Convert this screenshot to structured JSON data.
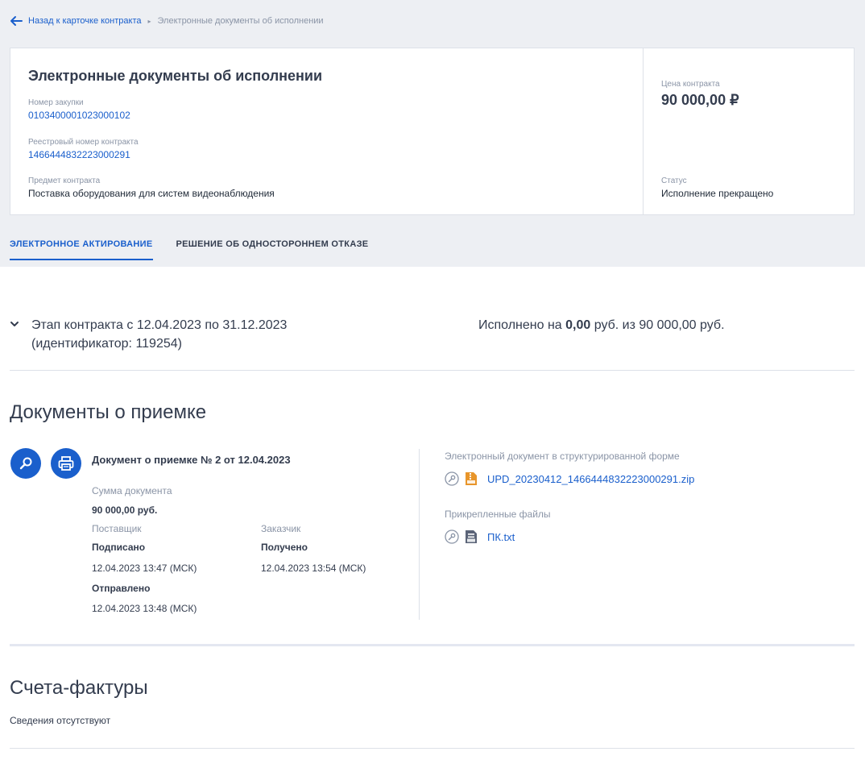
{
  "breadcrumb": {
    "back_label": "Назад к карточке контракта",
    "separator": "▸",
    "current": "Электронные документы об исполнении"
  },
  "card": {
    "title": "Электронные документы об исполнении",
    "purchase_number_label": "Номер закупки",
    "purchase_number": "0103400001023000102",
    "registry_number_label": "Реестровый номер контракта",
    "registry_number": "1466444832223000291",
    "subject_label": "Предмет контракта",
    "subject": "Поставка оборудования для систем видеонаблюдения",
    "price_label": "Цена контракта",
    "price": "90 000,00 ₽",
    "status_label": "Статус",
    "status": "Исполнение прекращено"
  },
  "tabs": [
    {
      "label": "ЭЛЕКТРОННОЕ АКТИРОВАНИЕ",
      "active": true
    },
    {
      "label": "РЕШЕНИЕ ОБ ОДНОСТОРОННЕМ ОТКАЗЕ",
      "active": false
    }
  ],
  "stage": {
    "title_line1": "Этап контракта с 12.04.2023 по 31.12.2023",
    "title_line2": "(идентификатор: 119254)",
    "done_prefix": "Исполнено на ",
    "done_amount": "0,00",
    "done_suffix": " руб. из 90 000,00 руб."
  },
  "acceptance": {
    "heading": "Документы о приемке",
    "document_title": "Документ о приемке № 2 от 12.04.2023",
    "sum_label": "Сумма документа",
    "sum": "90 000,00 руб.",
    "supplier_label": "Поставщик",
    "supplier_signed": "Подписано",
    "supplier_signed_time": "12.04.2023 13:47 (МСК)",
    "supplier_sent": "Отправлено",
    "supplier_sent_time": "12.04.2023 13:48 (МСК)",
    "customer_label": "Заказчик",
    "customer_received": "Получено",
    "customer_received_time": "12.04.2023 13:54 (МСК)",
    "structured_label": "Электронный документ в структурированной форме",
    "structured_file": "UPD_20230412_1466444832223000291.zip",
    "attached_label": "Прикрепленные файлы",
    "attached_file": "ПК.txt"
  },
  "invoices": {
    "heading": "Счета-фактуры",
    "empty_text": "Сведения отсутствуют"
  },
  "colors": {
    "accent": "#1a5fcc",
    "background_top": "#edeff3",
    "muted": "#8a94a6",
    "archive_icon": "#e8952a"
  },
  "icons": [
    "back-arrow-icon",
    "chevron-down-icon",
    "search-icon",
    "print-icon",
    "signature-icon",
    "zip-file-icon",
    "text-file-icon"
  ]
}
